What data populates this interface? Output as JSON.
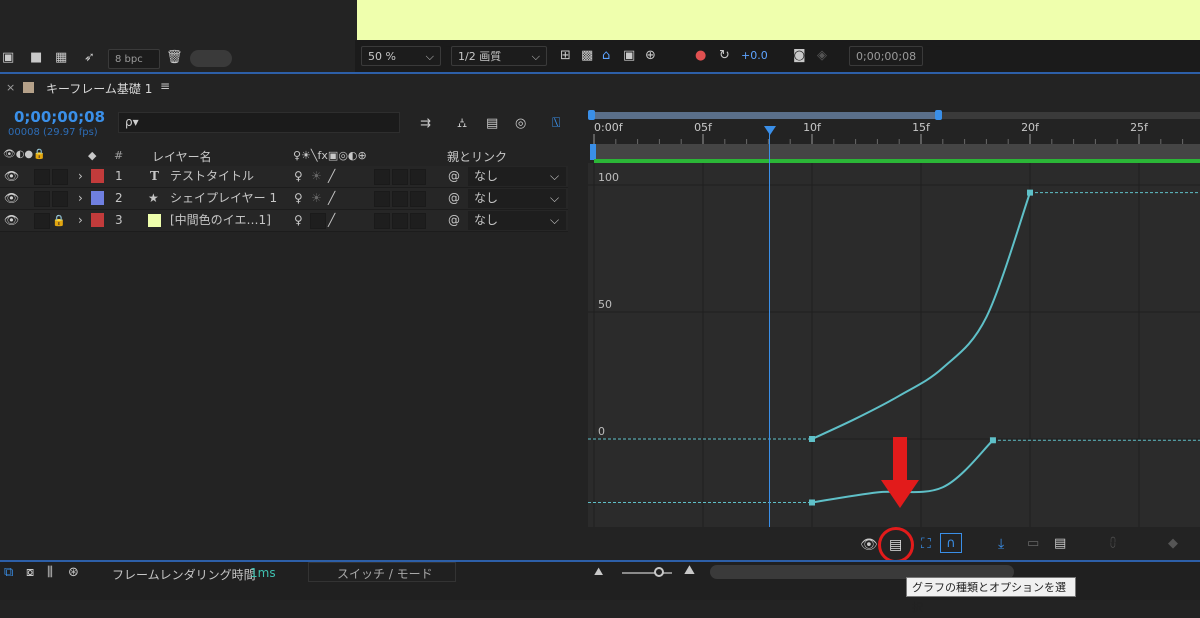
{
  "top": {
    "bpc_label": "8 bpc",
    "zoom": "50 %",
    "resolution": "1/2 画質",
    "exposure": "+0.0",
    "timecode": "0;00;00;08"
  },
  "panel": {
    "tab_label": "キーフレーム基礎 1",
    "current_time": "0;00;00;08",
    "frame_info": "00008 (29.97 fps)",
    "search_placeholder": "ρ▾"
  },
  "columns": {
    "layer_name": "レイヤー名",
    "hash": "#",
    "parent": "親とリンク",
    "switch_icons": "♀☀╲fx▣◎◐⊕"
  },
  "layers": [
    {
      "num": "1",
      "type_icon": "T",
      "name": "テストタイトル",
      "color": "#c23b3b",
      "parent": "なし",
      "locked": false
    },
    {
      "num": "2",
      "type_icon": "★",
      "name": "シェイプレイヤー 1",
      "color": "#6f7fe0",
      "parent": "なし",
      "locked": false
    },
    {
      "num": "3",
      "type_icon": "",
      "name": "[中間色のイエ…1]",
      "color": "#c23b3b",
      "parent": "なし",
      "locked": true
    }
  ],
  "ruler": {
    "ticks": [
      "0:00f",
      "05f",
      "10f",
      "15f",
      "20f",
      "25f"
    ]
  },
  "graph": {
    "y_labels": [
      "100",
      "50",
      "0"
    ]
  },
  "chart_data": {
    "type": "line",
    "title": "",
    "xlabel": "",
    "ylabel": "",
    "x_ticks": [
      "0:00f",
      "05f",
      "10f",
      "15f",
      "20f",
      "25f"
    ],
    "y_ticks": [
      "100",
      "50",
      "0"
    ],
    "ylim": [
      -25,
      105
    ],
    "current_frame": 8,
    "series": [
      {
        "points": [
          [
            10,
            0
          ],
          [
            12,
            8
          ],
          [
            14,
            17
          ],
          [
            16,
            28
          ],
          [
            18,
            48
          ],
          [
            20,
            97
          ]
        ],
        "color": "#5fc0c8"
      },
      {
        "points": [
          [
            10,
            -25
          ],
          [
            13,
            -21
          ],
          [
            16,
            -19
          ],
          [
            18.3,
            -0.5
          ]
        ],
        "color": "#5fc0c8"
      }
    ]
  },
  "footer": {
    "render_time_label": "フレームレンダリング時間",
    "render_time_value": "1ms",
    "switch_mode": "スイッチ / モード"
  },
  "tooltip": {
    "text": "グラフの種類とオプションを選択"
  },
  "colors": {
    "accent_blue": "#2d8ceb",
    "green_bar": "#2bb637",
    "curve": "#5fc0c8",
    "highlight_red": "#e21b1b"
  }
}
